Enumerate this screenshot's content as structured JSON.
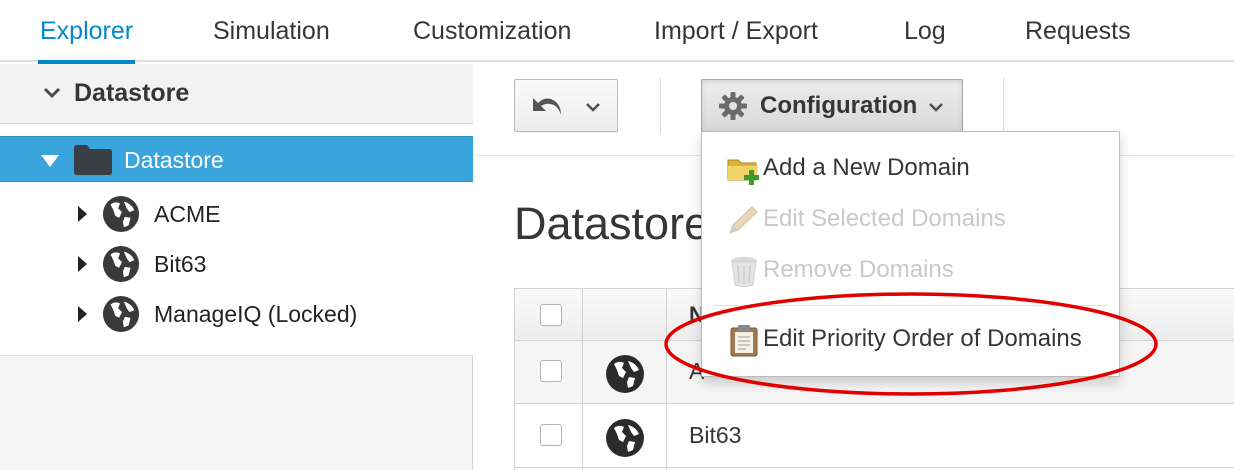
{
  "tabs": [
    {
      "label": "Explorer",
      "active": true
    },
    {
      "label": "Simulation"
    },
    {
      "label": "Customization"
    },
    {
      "label": "Import / Export"
    },
    {
      "label": "Log"
    },
    {
      "label": "Requests"
    }
  ],
  "sidebar": {
    "accordion_title": "Datastore",
    "tree": {
      "root": {
        "label": "Datastore",
        "icon": "folder-icon",
        "expanded": true,
        "selected": true
      },
      "children": [
        {
          "label": "ACME",
          "icon": "globe-icon"
        },
        {
          "label": "Bit63",
          "icon": "globe-icon"
        },
        {
          "label": "ManageIQ (Locked)",
          "icon": "globe-icon"
        }
      ]
    }
  },
  "toolbar": {
    "back_button": {
      "icon": "undo-icon"
    },
    "configuration": {
      "label": "Configuration",
      "icon": "gear-icon",
      "open": true
    }
  },
  "dropdown": {
    "items": [
      {
        "label": "Add a New Domain",
        "icon": "add-folder-icon",
        "enabled": true
      },
      {
        "label": "Edit Selected Domains",
        "icon": "pencil-icon",
        "enabled": false
      },
      {
        "label": "Remove Domains",
        "icon": "trash-icon",
        "enabled": false
      },
      {
        "label": "Edit Priority Order of Domains",
        "icon": "clipboard-icon",
        "enabled": true
      }
    ]
  },
  "main": {
    "title": "Datastore",
    "table": {
      "header_label": "N",
      "rows": [
        {
          "name": "A"
        },
        {
          "name": "Bit63"
        }
      ]
    }
  },
  "colors": {
    "accent": "#0088ce",
    "selected_row": "#39a5dc",
    "annotation": "#e00000"
  }
}
